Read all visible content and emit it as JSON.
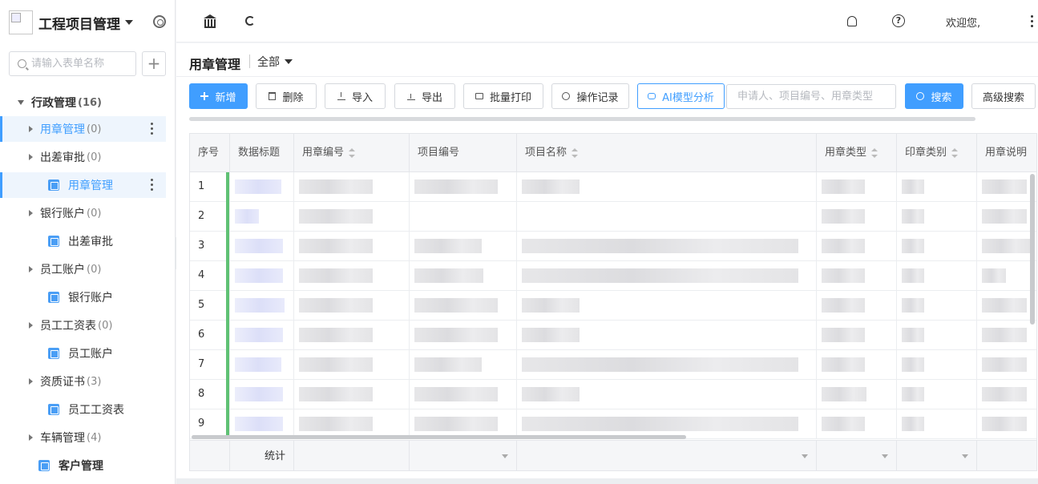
{
  "app": {
    "title": "工程项目管理"
  },
  "sidebar": {
    "search_placeholder": "请输入表单名称",
    "group": {
      "label": "行政管理",
      "count": "(16)"
    },
    "items": [
      {
        "type": "folder",
        "label": "用章管理",
        "count": "(0)",
        "active": true
      },
      {
        "type": "folder",
        "label": "出差审批",
        "count": "(0)"
      },
      {
        "type": "form",
        "label": "用章管理",
        "selected": true
      },
      {
        "type": "folder",
        "label": "银行账户",
        "count": "(0)"
      },
      {
        "type": "form",
        "label": "出差审批"
      },
      {
        "type": "folder",
        "label": "员工账户",
        "count": "(0)"
      },
      {
        "type": "form",
        "label": "银行账户"
      },
      {
        "type": "folder",
        "label": "员工工资表",
        "count": "(0)"
      },
      {
        "type": "form",
        "label": "员工账户"
      },
      {
        "type": "folder",
        "label": "资质证书",
        "count": "(3)"
      },
      {
        "type": "form",
        "label": "员工工资表"
      },
      {
        "type": "folder",
        "label": "车辆管理",
        "count": "(4)"
      },
      {
        "type": "form-bold",
        "label": "客户管理"
      }
    ]
  },
  "topbar": {
    "welcome": "欢迎您,"
  },
  "page": {
    "title": "用章管理",
    "scope": "全部"
  },
  "toolbar": {
    "new": "新增",
    "delete": "删除",
    "import": "导入",
    "export": "导出",
    "batch_print": "批量打印",
    "op_log": "操作记录",
    "ai": "AI模型分析",
    "search_placeholder": "申请人、项目编号、用章类型",
    "search": "搜索",
    "advanced": "高级搜索"
  },
  "table": {
    "columns": [
      "序号",
      "数据标题",
      "用章编号",
      "项目编号",
      "项目名称",
      "用章类型",
      "印章类别",
      "用章说明"
    ],
    "rows": [
      "1",
      "2",
      "3",
      "4",
      "5",
      "6",
      "7",
      "8",
      "9"
    ],
    "footer": "统计"
  },
  "colors": {
    "accent": "#409eff",
    "status_bar": "#5fc174"
  },
  "icons": [
    "settings-icon",
    "search-icon",
    "plus-icon",
    "bank-icon",
    "refresh-icon",
    "bell-icon",
    "help-icon",
    "more-vertical-icon",
    "trash-icon",
    "download-icon",
    "upload-icon",
    "printer-icon",
    "clock-icon",
    "robot-icon",
    "sort-icon"
  ]
}
